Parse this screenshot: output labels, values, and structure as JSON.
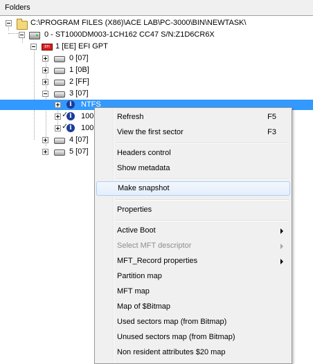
{
  "header": {
    "title": "Folders"
  },
  "tree": {
    "root": "C:\\PROGRAM FILES (X86)\\ACE LAB\\PC-3000\\BIN\\NEWTASK\\",
    "disk": "0 - ST1000DM003-1CH162 CC47 S/N:Z1D6CR6X",
    "gpt": "1 [EE] EFI GPT",
    "gpt_icon_text": "EFI",
    "partitions": [
      "0 [07]",
      "1 [0B]",
      "2 [FF]",
      "3 [07]"
    ],
    "children": [
      "NTFS",
      "100",
      "100"
    ],
    "partitions_after": [
      "4 [07]",
      "5 [07]"
    ]
  },
  "menu": {
    "items": [
      {
        "label": "Refresh",
        "shortcut": "F5"
      },
      {
        "label": "View the first sector",
        "shortcut": "F3"
      },
      {
        "label": "Headers control"
      },
      {
        "label": "Show metadata"
      },
      {
        "label": "Make snapshot"
      },
      {
        "label": "Properties"
      },
      {
        "label": "Active Boot"
      },
      {
        "label": "Select MFT descriptor"
      },
      {
        "label": "MFT_Record properties"
      },
      {
        "label": "Partition map"
      },
      {
        "label": "MFT map"
      },
      {
        "label": "Map of $Bitmap"
      },
      {
        "label": "Used sectors map (from Bitmap)"
      },
      {
        "label": "Unused sectors map (from Bitmap)"
      },
      {
        "label": "Non resident attributes $20 map"
      }
    ]
  },
  "colors": {
    "selection": "#3399ff",
    "menu_bg": "#f0f0f0",
    "disabled_text": "#8d8d8d"
  }
}
